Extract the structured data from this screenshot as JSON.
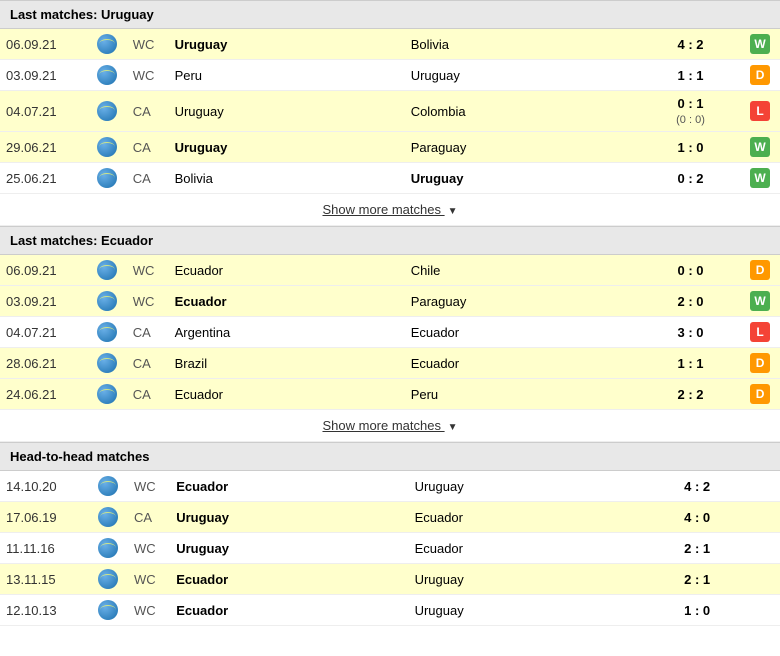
{
  "sections": [
    {
      "id": "uruguay",
      "header": "Last matches: Uruguay",
      "matches": [
        {
          "date": "06.09.21",
          "comp": "WC",
          "home": "Uruguay",
          "home_bold": true,
          "away": "Bolivia",
          "away_bold": false,
          "score": "4 : 2",
          "score_sub": "",
          "result": "W",
          "row": "highlight"
        },
        {
          "date": "03.09.21",
          "comp": "WC",
          "home": "Peru",
          "home_bold": false,
          "away": "Uruguay",
          "away_bold": false,
          "score": "1 : 1",
          "score_sub": "",
          "result": "D",
          "row": "normal"
        },
        {
          "date": "04.07.21",
          "comp": "CA",
          "home": "Uruguay",
          "home_bold": false,
          "away": "Colombia",
          "away_bold": false,
          "score": "0 : 1",
          "score_sub": "(0 : 0)",
          "result": "L",
          "row": "highlight"
        },
        {
          "date": "29.06.21",
          "comp": "CA",
          "home": "Uruguay",
          "home_bold": true,
          "away": "Paraguay",
          "away_bold": false,
          "score": "1 : 0",
          "score_sub": "",
          "result": "W",
          "row": "highlight"
        },
        {
          "date": "25.06.21",
          "comp": "CA",
          "home": "Bolivia",
          "home_bold": false,
          "away": "Uruguay",
          "away_bold": true,
          "score": "0 : 2",
          "score_sub": "",
          "result": "W",
          "row": "normal"
        }
      ]
    },
    {
      "id": "ecuador",
      "header": "Last matches: Ecuador",
      "matches": [
        {
          "date": "06.09.21",
          "comp": "WC",
          "home": "Ecuador",
          "home_bold": false,
          "away": "Chile",
          "away_bold": false,
          "score": "0 : 0",
          "score_sub": "",
          "result": "D",
          "row": "highlight"
        },
        {
          "date": "03.09.21",
          "comp": "WC",
          "home": "Ecuador",
          "home_bold": true,
          "away": "Paraguay",
          "away_bold": false,
          "score": "2 : 0",
          "score_sub": "",
          "result": "W",
          "row": "highlight"
        },
        {
          "date": "04.07.21",
          "comp": "CA",
          "home": "Argentina",
          "home_bold": false,
          "away": "Ecuador",
          "away_bold": false,
          "score": "3 : 0",
          "score_sub": "",
          "result": "L",
          "row": "normal"
        },
        {
          "date": "28.06.21",
          "comp": "CA",
          "home": "Brazil",
          "home_bold": false,
          "away": "Ecuador",
          "away_bold": false,
          "score": "1 : 1",
          "score_sub": "",
          "result": "D",
          "row": "highlight"
        },
        {
          "date": "24.06.21",
          "comp": "CA",
          "home": "Ecuador",
          "home_bold": false,
          "away": "Peru",
          "away_bold": false,
          "score": "2 : 2",
          "score_sub": "",
          "result": "D",
          "row": "highlight"
        }
      ]
    }
  ],
  "head_to_head": {
    "header": "Head-to-head matches",
    "matches": [
      {
        "date": "14.10.20",
        "comp": "WC",
        "home": "Ecuador",
        "home_bold": true,
        "away": "Uruguay",
        "away_bold": false,
        "score": "4 : 2",
        "row": "normal"
      },
      {
        "date": "17.06.19",
        "comp": "CA",
        "home": "Uruguay",
        "home_bold": true,
        "away": "Ecuador",
        "away_bold": false,
        "score": "4 : 0",
        "row": "highlight"
      },
      {
        "date": "11.11.16",
        "comp": "WC",
        "home": "Uruguay",
        "home_bold": true,
        "away": "Ecuador",
        "away_bold": false,
        "score": "2 : 1",
        "row": "normal"
      },
      {
        "date": "13.11.15",
        "comp": "WC",
        "home": "Ecuador",
        "home_bold": true,
        "away": "Uruguay",
        "away_bold": false,
        "score": "2 : 1",
        "row": "highlight"
      },
      {
        "date": "12.10.13",
        "comp": "WC",
        "home": "Ecuador",
        "home_bold": true,
        "away": "Uruguay",
        "away_bold": false,
        "score": "1 : 0",
        "row": "normal"
      }
    ]
  },
  "show_more_label": "Show more matches",
  "colors": {
    "W": "#4caf50",
    "D": "#ff9800",
    "L": "#f44336"
  }
}
